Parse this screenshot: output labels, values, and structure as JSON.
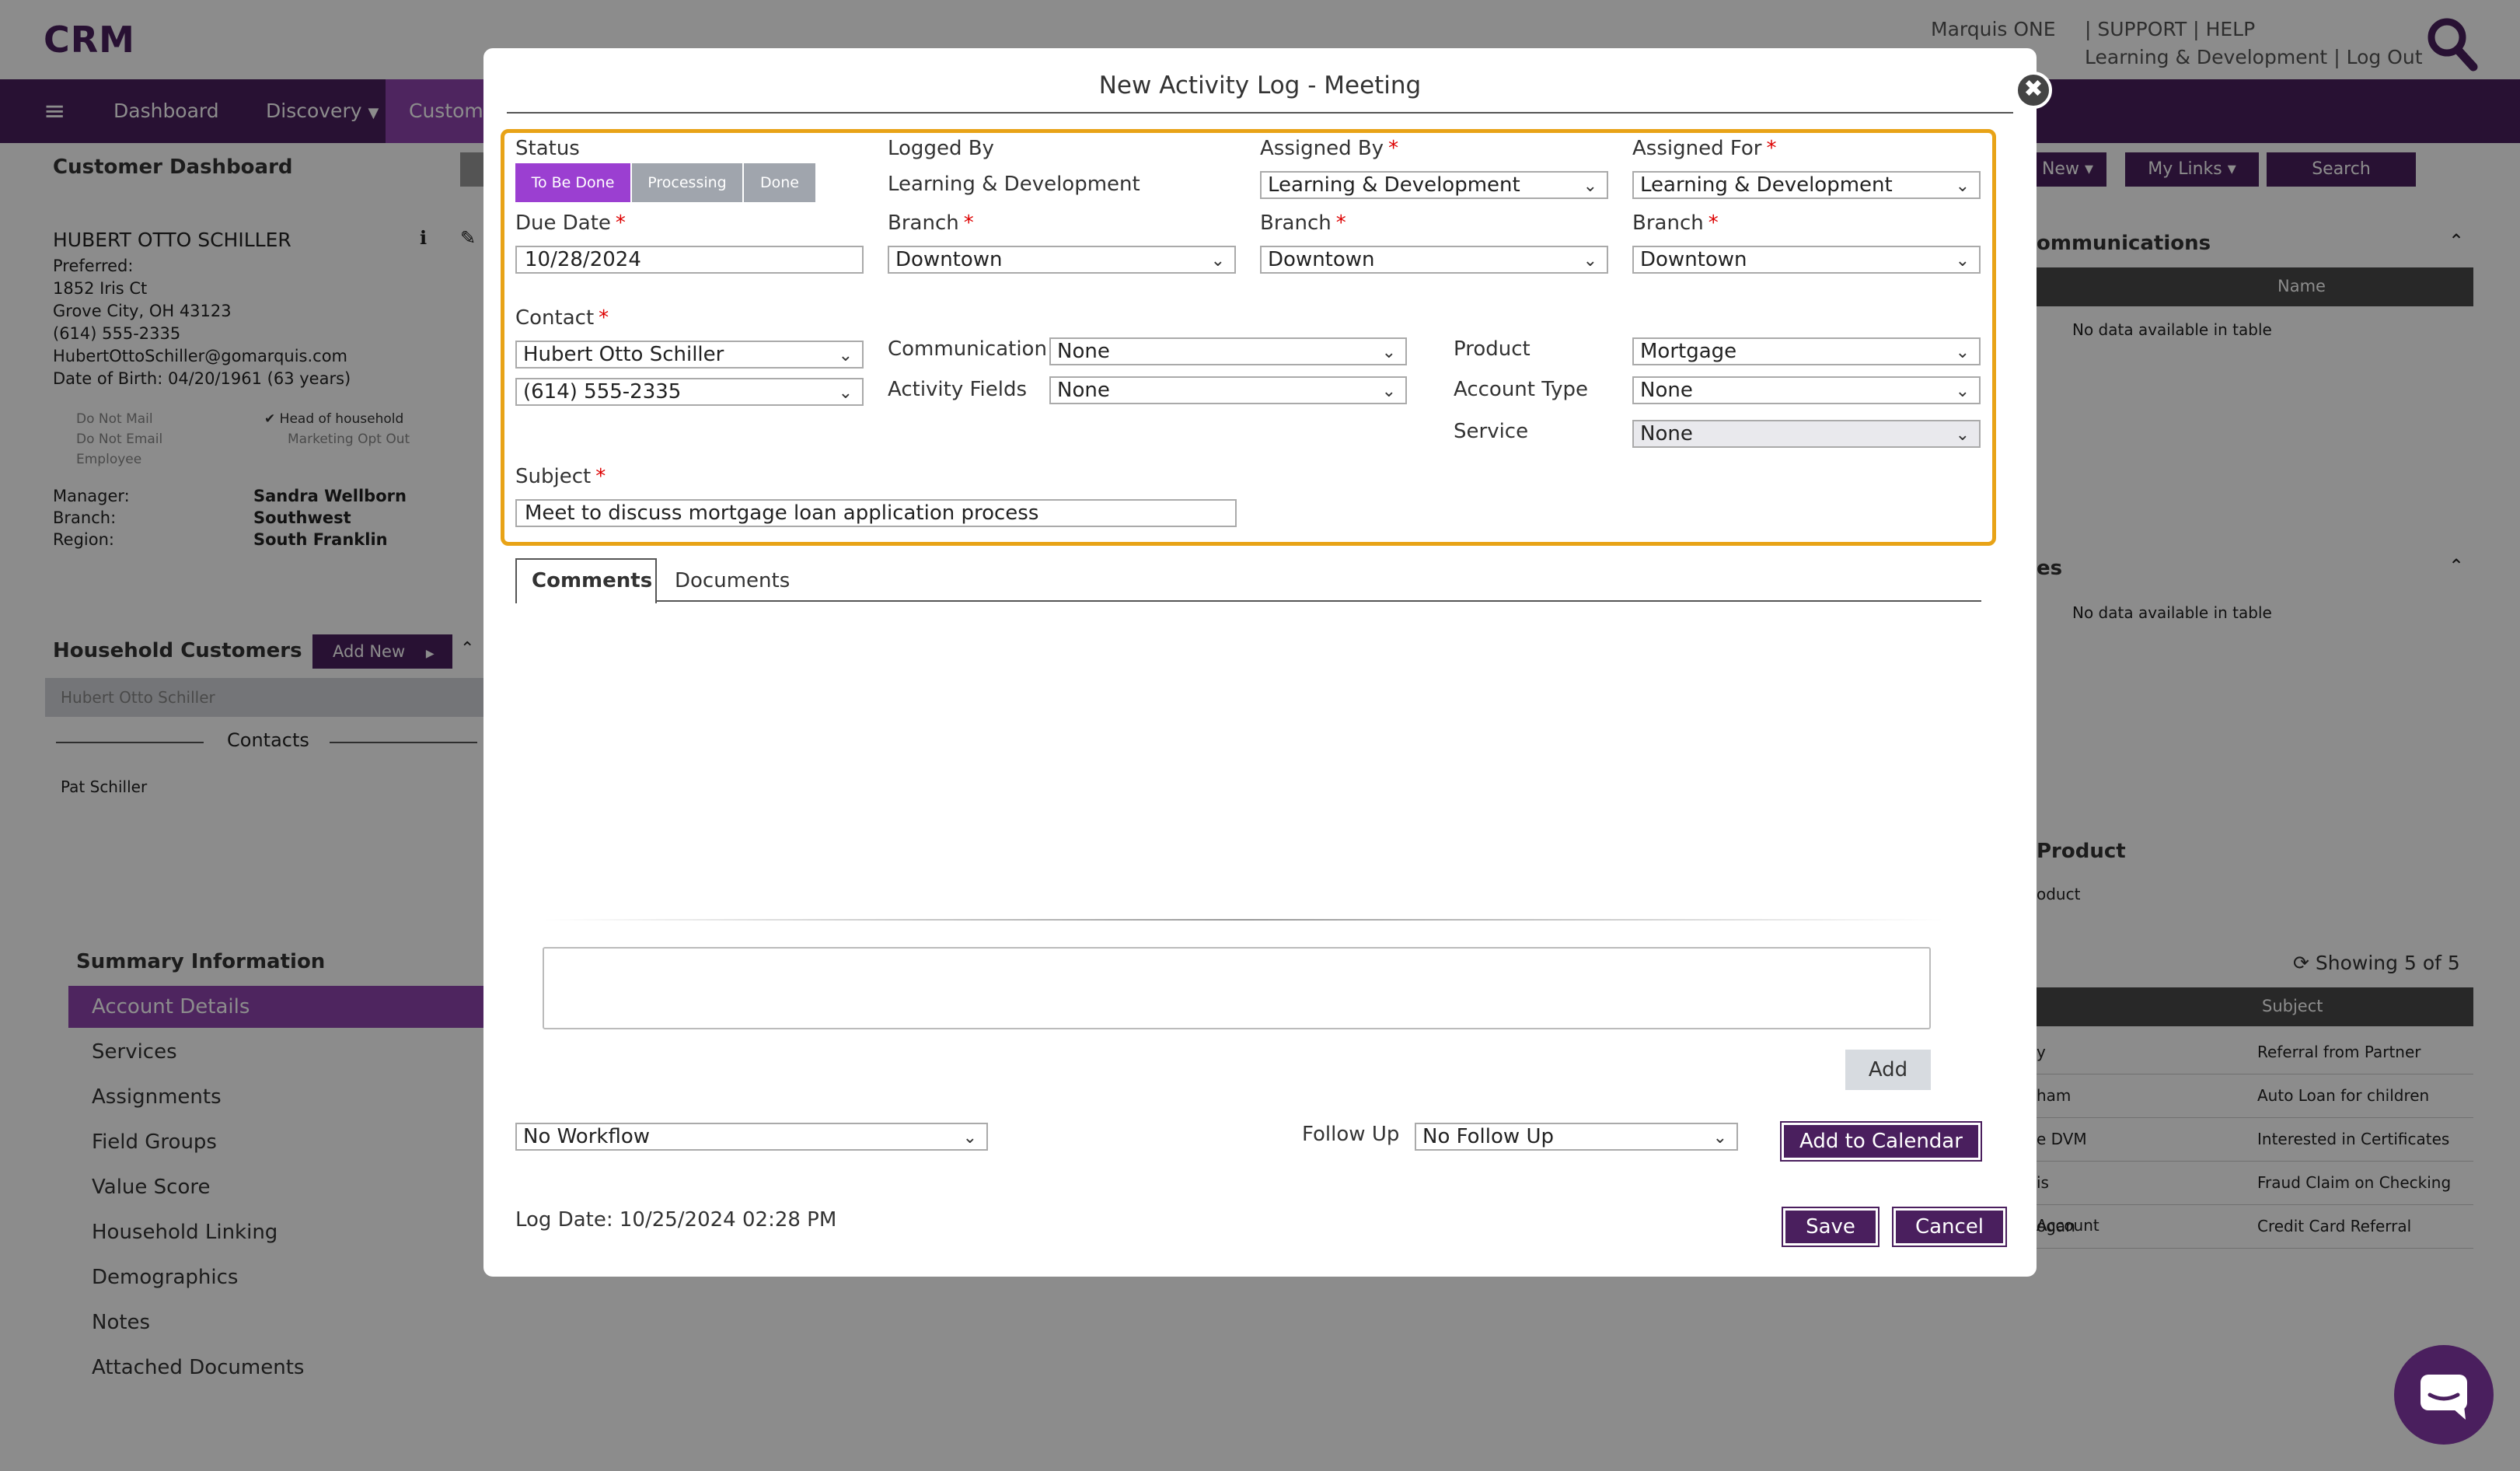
{
  "app": {
    "title": "CRM",
    "logo": "marquis"
  },
  "top": {
    "user": "Marquis ONE",
    "support": "SUPPORT",
    "help": "HELP",
    "sep": "|",
    "dept": "Learning & Development",
    "logout": "Log Out"
  },
  "nav": {
    "menu_icon": "≡",
    "items": [
      "Dashboard",
      "Discovery",
      "Custome"
    ]
  },
  "subnav": {
    "new": "New",
    "mylinks": "My Links",
    "search": "Search"
  },
  "dashboard": {
    "title": "Customer Dashboard",
    "customer": {
      "name": "HUBERT OTTO SCHILLER",
      "preferred": "Preferred:",
      "address1": "1852 Iris Ct",
      "address2": "Grove City, OH 43123",
      "phone": "(614) 555-2335",
      "email": "HubertOttoSchiller@gomarquis.com",
      "dob": "Date of Birth: 04/20/1961 (63 years)",
      "flags": [
        "Do Not Mail",
        "Do Not Email",
        "Employee"
      ],
      "flags2": [
        "Head of household",
        "Marketing Opt Out"
      ],
      "manager_label": "Manager:",
      "manager": "Sandra Wellborn",
      "branch_label": "Branch:",
      "branch": "Southwest",
      "region_label": "Region:",
      "region": "South Franklin"
    },
    "household": {
      "title": "Household Customers",
      "add_new": "Add New",
      "member": "Hubert Otto Schiller",
      "contacts": "Contacts",
      "contact": "Pat Schiller"
    },
    "summary": {
      "title": "Summary Information",
      "items": [
        "Account Details",
        "Services",
        "Assignments",
        "Field Groups",
        "Value Score",
        "Household Linking",
        "Demographics",
        "Notes",
        "Attached Documents"
      ]
    }
  },
  "right": {
    "comm_title": "ommunications",
    "name_col": "Name",
    "no_data": "No data available in table",
    "es_title": "es",
    "no_data2": "No data available in table",
    "product_title": "Product",
    "product_sub": "oduct",
    "showing": "Showing 5 of 5",
    "subject_col": "Subject",
    "rows": [
      {
        "left": "y",
        "subject": "Referral from Partner"
      },
      {
        "left": "ham",
        "subject": "Auto Loan for children"
      },
      {
        "left": "e DVM",
        "subject": "Interested in Certificates"
      },
      {
        "left": "is",
        "subject": "Fraud Claim on Checking Account"
      },
      {
        "left": "ogan",
        "subject": "Credit Card Referral"
      }
    ]
  },
  "modal": {
    "title": "New Activity Log - Meeting",
    "status_label": "Status",
    "status_buttons": [
      "To Be Done",
      "Processing",
      "Done"
    ],
    "logged_by_label": "Logged By",
    "logged_by": "Learning & Development",
    "assigned_by_label": "Assigned By",
    "assigned_by": "Learning & Development",
    "assigned_for_label": "Assigned For",
    "assigned_for": "Learning & Development",
    "due_date_label": "Due Date",
    "due_date": "10/28/2024",
    "branch_label": "Branch",
    "branch1": "Downtown",
    "branch2": "Downtown",
    "branch3": "Downtown",
    "contact_label": "Contact",
    "contact": "Hubert Otto Schiller",
    "contact_phone": "(614) 555-2335",
    "communication_label": "Communication",
    "communication": "None",
    "activity_fields_label": "Activity Fields",
    "activity_fields": "None",
    "product_label": "Product",
    "product": "Mortgage",
    "account_type_label": "Account Type",
    "account_type": "None",
    "service_label": "Service",
    "service": "None",
    "subject_label": "Subject",
    "subject": "Meet to discuss mortgage loan application process",
    "tabs": [
      "Comments",
      "Documents"
    ],
    "add": "Add",
    "workflow": "No Workflow",
    "follow_up_label": "Follow Up",
    "follow_up": "No Follow Up",
    "add_calendar": "Add to Calendar",
    "log_date": "Log Date: 10/25/2024 02:28 PM",
    "save": "Save",
    "cancel": "Cancel",
    "required_mark": "*"
  },
  "colors": {
    "brand": "#4a1f5e",
    "accent": "#8e44ad",
    "highlight": "#e8a317"
  }
}
